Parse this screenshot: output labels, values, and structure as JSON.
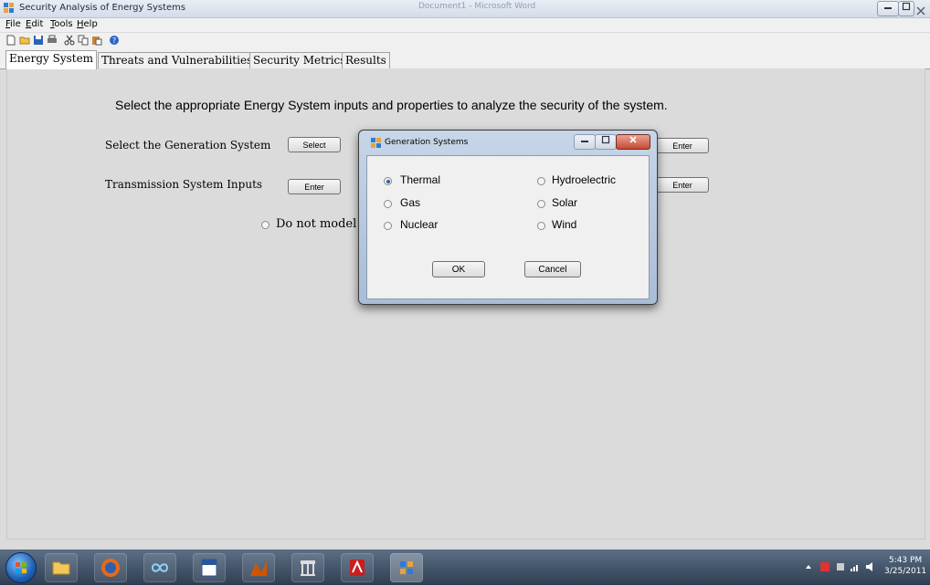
{
  "window": {
    "title": "Security Analysis of Energy Systems",
    "background_titles": [
      "Document1 - Microsoft Word"
    ],
    "controls": [
      "minimize",
      "maximize",
      "close"
    ]
  },
  "menu": {
    "items": [
      "File",
      "Edit",
      "Tools",
      "Help"
    ]
  },
  "toolbar": {
    "icons": [
      "new-icon",
      "open-icon",
      "save-icon",
      "print-icon",
      "cut-icon",
      "copy-icon",
      "paste-icon",
      "help-icon"
    ]
  },
  "tabs": [
    {
      "label": "Energy System",
      "active": true
    },
    {
      "label": "Threats and Vulnerabilities",
      "active": false
    },
    {
      "label": "Security Metrics",
      "active": false
    },
    {
      "label": "Results",
      "active": false
    }
  ],
  "main": {
    "heading": "Select the appropriate Energy System inputs and properties to analyze the security of the system.",
    "generation_label": "Select the Generation System",
    "generation_button": "Select",
    "transmission_label": "Transmission System Inputs",
    "transmission_button": "Enter",
    "right_button_1": "Enter",
    "right_button_2": "Enter",
    "radio_label": "Do not model C"
  },
  "dialog": {
    "title": "Generation Systems",
    "options_left": [
      {
        "label": "Thermal",
        "selected": true
      },
      {
        "label": "Gas",
        "selected": false
      },
      {
        "label": "Nuclear",
        "selected": false
      }
    ],
    "options_right": [
      {
        "label": "Hydroelectric",
        "selected": false
      },
      {
        "label": "Solar",
        "selected": false
      },
      {
        "label": "Wind",
        "selected": false
      }
    ],
    "ok": "OK",
    "cancel": "Cancel"
  },
  "taskbar": {
    "time": "5:43 PM",
    "date": "3/25/2011"
  },
  "colors": {
    "panel_bg": "#dbdbdb",
    "radio_selected": "#2b5fa8"
  }
}
